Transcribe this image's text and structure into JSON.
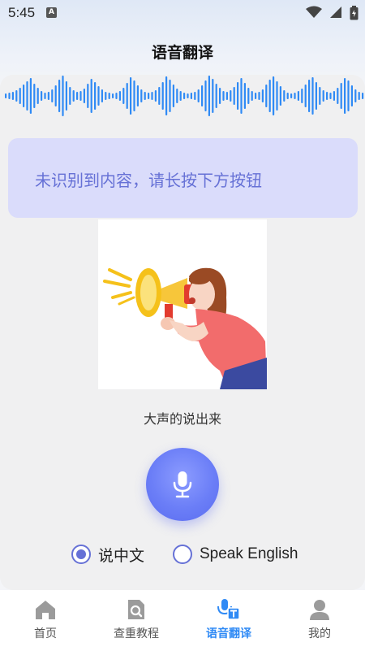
{
  "status_bar": {
    "time": "5:45",
    "app_icon": "A",
    "icons": [
      "wifi-icon",
      "cellular-signal-icon",
      "battery-icon"
    ]
  },
  "header": {
    "title": "语音翻译"
  },
  "notice": {
    "text": "未识别到内容，请长按下方按钮"
  },
  "illustration": {
    "caption": "大声的说出来",
    "image": "woman-with-megaphone"
  },
  "mic_button": {
    "icon": "microphone-icon"
  },
  "language_options": [
    {
      "label": "说中文",
      "selected": true
    },
    {
      "label": "Speak English",
      "selected": false
    }
  ],
  "bottom_nav": {
    "items": [
      {
        "label": "首页",
        "icon": "home-icon",
        "active": false
      },
      {
        "label": "查重教程",
        "icon": "document-search-icon",
        "active": false
      },
      {
        "label": "语音翻译",
        "icon": "voice-translate-icon",
        "active": true
      },
      {
        "label": "我的",
        "icon": "profile-icon",
        "active": false
      }
    ]
  },
  "colors": {
    "accent": "#6671d6",
    "notice_bg": "#dadcfb",
    "waveform": "#2f8af5",
    "nav_active": "#2f8af5",
    "mic_gradient": [
      "#8c9cff",
      "#5a6cf0"
    ]
  }
}
